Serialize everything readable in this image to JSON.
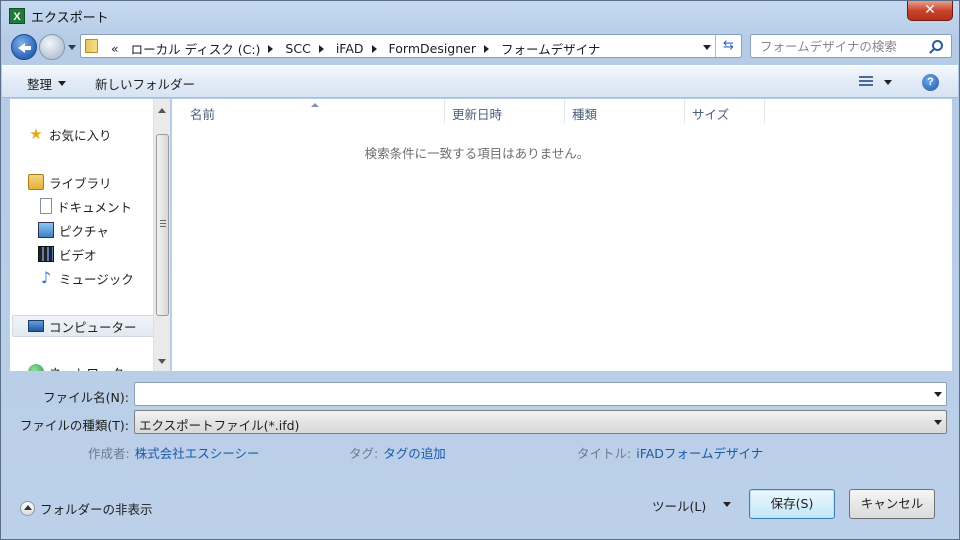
{
  "window": {
    "title": "エクスポート",
    "app_icon": "X",
    "close_glyph": "✕"
  },
  "address": {
    "overflow": "«",
    "crumbs": [
      "ローカル ディスク (C:)",
      "SCC",
      "iFAD",
      "FormDesigner",
      "フォームデザイナ"
    ],
    "refresh_glyph": "⇆"
  },
  "search": {
    "placeholder": "フォームデザイナの検索"
  },
  "toolbar": {
    "organize": "整理",
    "new_folder": "新しいフォルダー",
    "help": "?"
  },
  "navpane": {
    "items": [
      {
        "label": "お気に入り",
        "icon": "star-icon"
      },
      {
        "label": "ライブラリ",
        "icon": "library-icon"
      },
      {
        "label": "ドキュメント",
        "icon": "document-icon"
      },
      {
        "label": "ピクチャ",
        "icon": "picture-icon"
      },
      {
        "label": "ビデオ",
        "icon": "video-icon"
      },
      {
        "label": "ミュージック",
        "icon": "music-icon"
      },
      {
        "label": "コンピューター",
        "icon": "computer-icon",
        "selected": true
      },
      {
        "label": "ネットワーク",
        "icon": "network-icon"
      }
    ]
  },
  "filelist": {
    "columns": [
      "名前",
      "更新日時",
      "種類",
      "サイズ"
    ],
    "empty_message": "検索条件に一致する項目はありません。"
  },
  "form": {
    "filename_label": "ファイル名(N):",
    "filename_value": "",
    "filetype_label": "ファイルの種類(T):",
    "filetype_value": "エクスポートファイル(*.ifd)"
  },
  "meta": {
    "author_label": "作成者:",
    "author_value": "株式会社エスシーシー",
    "tag_label": "タグ:",
    "tag_value": "タグの追加",
    "title_label": "タイトル:",
    "title_value": "iFADフォームデザイナ"
  },
  "footer": {
    "hide_folders": "フォルダーの非表示",
    "tools": "ツール(L)",
    "save": "保存(S)",
    "cancel": "キャンセル"
  }
}
